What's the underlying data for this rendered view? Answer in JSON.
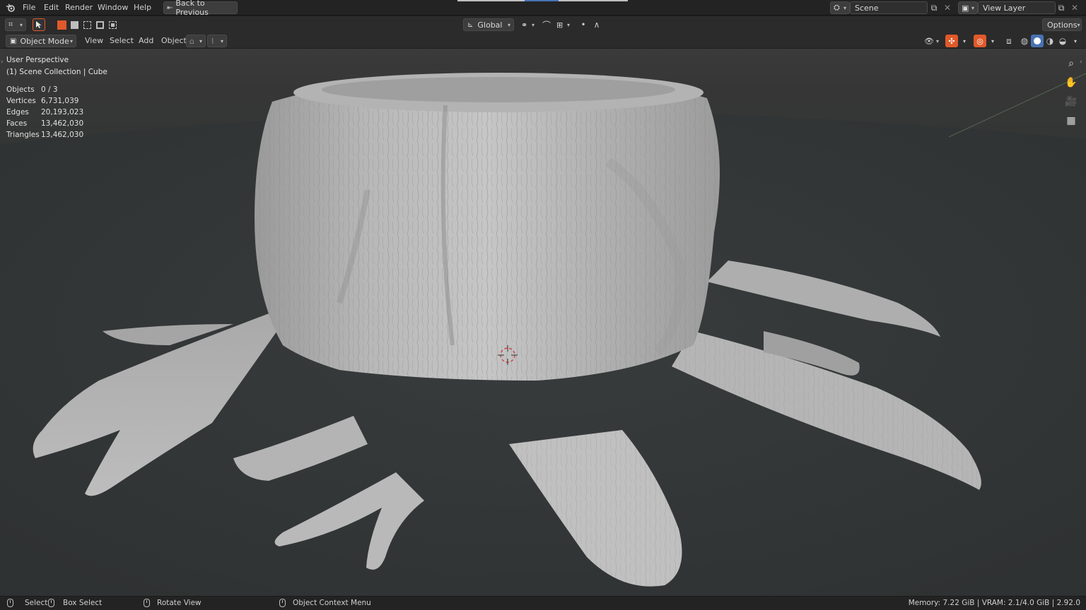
{
  "menu": {
    "items": [
      "File",
      "Edit",
      "Render",
      "Window",
      "Help"
    ],
    "back_label": "Back to Previous"
  },
  "scene": {
    "name": "Scene",
    "view_layer": "View Layer"
  },
  "toolbar": {
    "orientation": "Global",
    "options_label": "Options"
  },
  "header": {
    "mode": "Object Mode",
    "menus": [
      "View",
      "Select",
      "Add",
      "Object"
    ]
  },
  "viewport": {
    "perspective": "User Perspective",
    "collection": "(1) Scene Collection | Cube",
    "stats": [
      {
        "label": "Objects",
        "value": "0 / 3"
      },
      {
        "label": "Vertices",
        "value": "6,731,039"
      },
      {
        "label": "Edges",
        "value": "20,193,023"
      },
      {
        "label": "Faces",
        "value": "13,462,030"
      },
      {
        "label": "Triangles",
        "value": "13,462,030"
      }
    ]
  },
  "status": {
    "select": "Select",
    "box_select": "Box Select",
    "rotate_view": "Rotate View",
    "context_menu": "Object Context Menu",
    "memory": "Memory: 7.22 GiB | VRAM: 2.1/4.0 GiB | 2.92.0"
  },
  "colors": {
    "accent": "#e0592a",
    "active_blue": "#4772b3"
  }
}
